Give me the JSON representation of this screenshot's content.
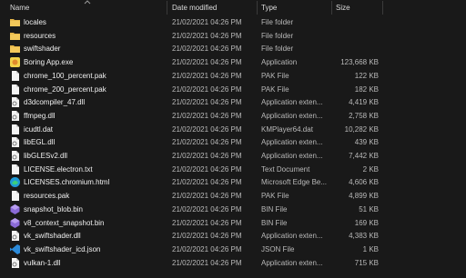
{
  "columns": {
    "name": "Name",
    "date": "Date modified",
    "type": "Type",
    "size": "Size"
  },
  "files": [
    {
      "icon": "folder-icon",
      "name": "locales",
      "date": "21/02/2021 04:26 PM",
      "type": "File folder",
      "size": ""
    },
    {
      "icon": "folder-icon",
      "name": "resources",
      "date": "21/02/2021 04:26 PM",
      "type": "File folder",
      "size": ""
    },
    {
      "icon": "folder-icon",
      "name": "swiftshader",
      "date": "21/02/2021 04:26 PM",
      "type": "File folder",
      "size": ""
    },
    {
      "icon": "app-icon",
      "name": "Boring App.exe",
      "date": "21/02/2021 04:26 PM",
      "type": "Application",
      "size": "123,668 KB"
    },
    {
      "icon": "file-icon",
      "name": "chrome_100_percent.pak",
      "date": "21/02/2021 04:26 PM",
      "type": "PAK File",
      "size": "122 KB"
    },
    {
      "icon": "file-icon",
      "name": "chrome_200_percent.pak",
      "date": "21/02/2021 04:26 PM",
      "type": "PAK File",
      "size": "182 KB"
    },
    {
      "icon": "dll-icon",
      "name": "d3dcompiler_47.dll",
      "date": "21/02/2021 04:26 PM",
      "type": "Application exten...",
      "size": "4,419 KB"
    },
    {
      "icon": "dll-icon",
      "name": "ffmpeg.dll",
      "date": "21/02/2021 04:26 PM",
      "type": "Application exten...",
      "size": "2,758 KB"
    },
    {
      "icon": "file-icon",
      "name": "icudtl.dat",
      "date": "21/02/2021 04:26 PM",
      "type": "KMPlayer64.dat",
      "size": "10,282 KB"
    },
    {
      "icon": "dll-icon",
      "name": "libEGL.dll",
      "date": "21/02/2021 04:26 PM",
      "type": "Application exten...",
      "size": "439 KB"
    },
    {
      "icon": "dll-icon",
      "name": "libGLESv2.dll",
      "date": "21/02/2021 04:26 PM",
      "type": "Application exten...",
      "size": "7,442 KB"
    },
    {
      "icon": "file-icon",
      "name": "LICENSE.electron.txt",
      "date": "21/02/2021 04:26 PM",
      "type": "Text Document",
      "size": "2 KB"
    },
    {
      "icon": "edge-icon",
      "name": "LICENSES.chromium.html",
      "date": "21/02/2021 04:26 PM",
      "type": "Microsoft Edge Be...",
      "size": "4,606 KB"
    },
    {
      "icon": "file-icon",
      "name": "resources.pak",
      "date": "21/02/2021 04:26 PM",
      "type": "PAK File",
      "size": "4,899 KB"
    },
    {
      "icon": "bin-icon",
      "name": "snapshot_blob.bin",
      "date": "21/02/2021 04:26 PM",
      "type": "BIN File",
      "size": "51 KB"
    },
    {
      "icon": "bin-icon",
      "name": "v8_context_snapshot.bin",
      "date": "21/02/2021 04:26 PM",
      "type": "BIN File",
      "size": "169 KB"
    },
    {
      "icon": "dll-icon",
      "name": "vk_swiftshader.dll",
      "date": "21/02/2021 04:26 PM",
      "type": "Application exten...",
      "size": "4,383 KB"
    },
    {
      "icon": "vscode-icon",
      "name": "vk_swiftshader_icd.json",
      "date": "21/02/2021 04:26 PM",
      "type": "JSON File",
      "size": "1 KB"
    },
    {
      "icon": "dll-icon",
      "name": "vulkan-1.dll",
      "date": "21/02/2021 04:26 PM",
      "type": "Application exten...",
      "size": "715 KB"
    }
  ]
}
